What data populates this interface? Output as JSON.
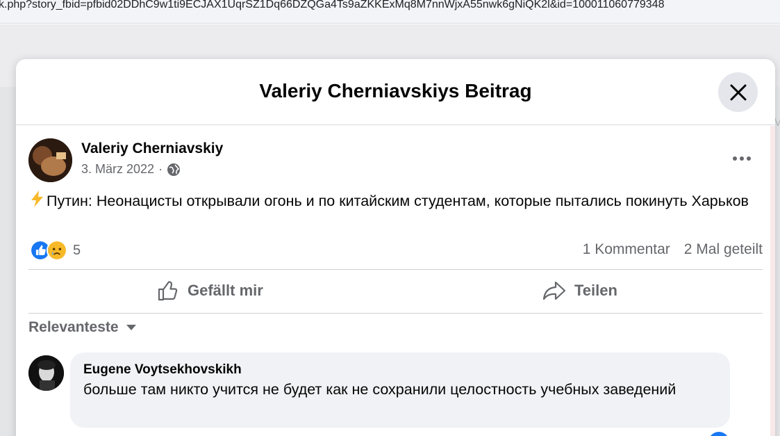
{
  "browser": {
    "url": "k.php?story_fbid=pfbid02DDhC9w1ti9ECJAX1UqrSZ1Dq66DZQGa4Ts9aZKKExMq8M7nnWjxA55nwk6gNiQK2l&id=100011060779348"
  },
  "modal": {
    "title": "Valeriy Cherniavskiys Beitrag",
    "close_icon": "close-icon"
  },
  "post": {
    "author": "Valeriy Cherniavskiy",
    "date": "3. März 2022",
    "separator": "·",
    "privacy_icon": "globe-icon",
    "more_icon": "more-dots-icon",
    "text": "Путин: Неонацисты открывали огонь и по китайским студентам, которые пытались покинуть Харьков",
    "leading_emoji": "lightning-icon",
    "reaction_icons": [
      "like-icon",
      "sad-icon"
    ],
    "reaction_count": "5",
    "comments_count": "1 Kommentar",
    "shares_count": "2 Mal geteilt",
    "like_label": "Gefällt mir",
    "share_label": "Teilen"
  },
  "comments": {
    "sort_label": "Relevanteste",
    "items": [
      {
        "author": "Eugene Voytsekhovskikh",
        "text": "больше там никто учится не будет как не сохранили целостность учебных заведений"
      }
    ]
  },
  "colors": {
    "meta_gray": "#65676b",
    "like_blue": "#1877f2",
    "bubble_bg": "#f0f2f5",
    "divider": "#ced0d4"
  }
}
